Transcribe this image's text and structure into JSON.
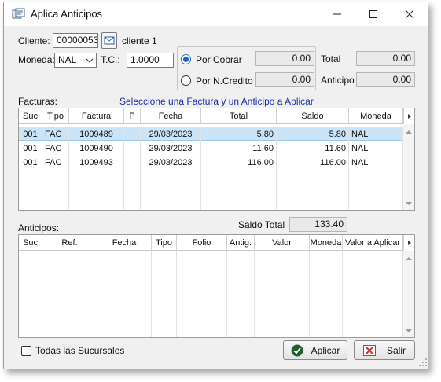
{
  "window": {
    "title": "Aplica Anticipos"
  },
  "cliente": {
    "label": "Cliente:",
    "code": "00000053",
    "name": "cliente 1"
  },
  "moneda": {
    "label": "Moneda:",
    "value": "NAL",
    "tc_label": "T.C.:",
    "tc_value": "1.0000"
  },
  "mode": {
    "por_cobrar_label": "Por Cobrar",
    "por_cobrar_value": "0.00",
    "por_ncredito_label": "Por N.Credito",
    "por_ncredito_value": "0.00",
    "selected": "por_cobrar"
  },
  "totals": {
    "total_label": "Total",
    "total_value": "0.00",
    "anticipo_label": "Anticipo",
    "anticipo_value": "0.00"
  },
  "facturas": {
    "title": "Facturas:",
    "hint": "Seleccione una Factura y un Anticipo a Aplicar",
    "columns": [
      "Suc",
      "Tipo",
      "Factura",
      "P",
      "Fecha",
      "Total",
      "Saldo",
      "Moneda"
    ],
    "rows": [
      {
        "suc": "001",
        "tipo": "FAC",
        "factura": "1009489",
        "p": "",
        "fecha": "29/03/2023",
        "total": "5.80",
        "saldo": "5.80",
        "moneda": "NAL"
      },
      {
        "suc": "001",
        "tipo": "FAC",
        "factura": "1009490",
        "p": "",
        "fecha": "29/03/2023",
        "total": "11.60",
        "saldo": "11.60",
        "moneda": "NAL"
      },
      {
        "suc": "001",
        "tipo": "FAC",
        "factura": "1009493",
        "p": "",
        "fecha": "29/03/2023",
        "total": "116.00",
        "saldo": "116.00",
        "moneda": "NAL"
      }
    ],
    "saldo_total_label": "Saldo Total",
    "saldo_total_value": "133.40"
  },
  "anticipos": {
    "title": "Anticipos:",
    "columns": [
      "Suc",
      "Ref.",
      "Fecha",
      "Tipo",
      "Folio",
      "Antig.",
      "Valor",
      "Moneda",
      "Valor a Aplicar"
    ]
  },
  "footer": {
    "todas_label": "Todas las Sucursales",
    "aplicar_label": "Aplicar",
    "salir_label": "Salir"
  },
  "colors": {
    "selected_row": "#cce4f7",
    "accent": "#1f63c3",
    "hint_text": "#1a2fa8"
  },
  "icons": [
    "app-icon",
    "minimize-icon",
    "maximize-icon",
    "close-icon",
    "mail-icon",
    "chevron-down-icon",
    "checkmark-icon",
    "cancel-icon",
    "scroll-arrow-icon",
    "resize-grip-icon"
  ]
}
